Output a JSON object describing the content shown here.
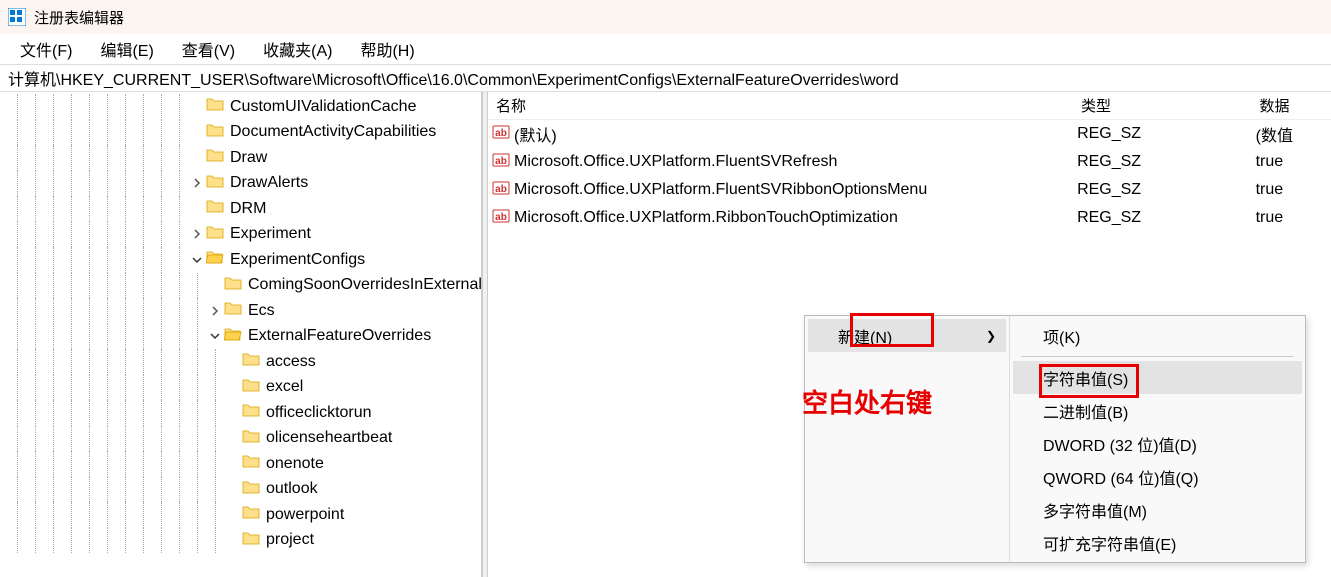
{
  "window": {
    "title": "注册表编辑器"
  },
  "menu": {
    "file": "文件(F)",
    "edit": "编辑(E)",
    "view": "查看(V)",
    "favorites": "收藏夹(A)",
    "help": "帮助(H)"
  },
  "address": "计算机\\HKEY_CURRENT_USER\\Software\\Microsoft\\Office\\16.0\\Common\\ExperimentConfigs\\ExternalFeatureOverrides\\word",
  "tree": [
    {
      "depth": 10,
      "chevron": "",
      "label": "CustomUIValidationCache"
    },
    {
      "depth": 10,
      "chevron": "",
      "label": "DocumentActivityCapabilities"
    },
    {
      "depth": 10,
      "chevron": "",
      "label": "Draw"
    },
    {
      "depth": 10,
      "chevron": ">",
      "label": "DrawAlerts"
    },
    {
      "depth": 10,
      "chevron": "",
      "label": "DRM"
    },
    {
      "depth": 10,
      "chevron": ">",
      "label": "Experiment"
    },
    {
      "depth": 10,
      "chevron": "v",
      "label": "ExperimentConfigs"
    },
    {
      "depth": 11,
      "chevron": "",
      "label": "ComingSoonOverridesInExternalFeatureOverrides"
    },
    {
      "depth": 11,
      "chevron": ">",
      "label": "Ecs"
    },
    {
      "depth": 11,
      "chevron": "v",
      "label": "ExternalFeatureOverrides"
    },
    {
      "depth": 12,
      "chevron": "",
      "label": "access"
    },
    {
      "depth": 12,
      "chevron": "",
      "label": "excel"
    },
    {
      "depth": 12,
      "chevron": "",
      "label": "officeclicktorun"
    },
    {
      "depth": 12,
      "chevron": "",
      "label": "olicenseheartbeat"
    },
    {
      "depth": 12,
      "chevron": "",
      "label": "onenote"
    },
    {
      "depth": 12,
      "chevron": "",
      "label": "outlook"
    },
    {
      "depth": 12,
      "chevron": "",
      "label": "powerpoint"
    },
    {
      "depth": 12,
      "chevron": "",
      "label": "project"
    }
  ],
  "values_header": {
    "name": "名称",
    "type": "类型",
    "data": "数据"
  },
  "values": [
    {
      "name": "(默认)",
      "type": "REG_SZ",
      "data": "(数值"
    },
    {
      "name": "Microsoft.Office.UXPlatform.FluentSVRefresh",
      "type": "REG_SZ",
      "data": "true"
    },
    {
      "name": "Microsoft.Office.UXPlatform.FluentSVRibbonOptionsMenu",
      "type": "REG_SZ",
      "data": "true"
    },
    {
      "name": "Microsoft.Office.UXPlatform.RibbonTouchOptimization",
      "type": "REG_SZ",
      "data": "true"
    }
  ],
  "context_menu": {
    "new": "新建(N)",
    "submenu": [
      "项(K)",
      "字符串值(S)",
      "二进制值(B)",
      "DWORD (32 位)值(D)",
      "QWORD (64 位)值(Q)",
      "多字符串值(M)",
      "可扩充字符串值(E)"
    ]
  },
  "annotation": "空白处右键"
}
